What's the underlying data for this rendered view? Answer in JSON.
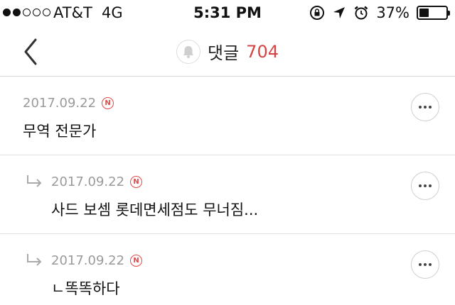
{
  "status_bar": {
    "carrier": "AT&T",
    "network": "4G",
    "time": "5:31 PM",
    "battery_percent": "37%",
    "battery_level": 0.37,
    "signal_bars_filled": 2,
    "signal_bars_total": 5,
    "icons": [
      "rotation-lock-icon",
      "location-arrow-icon",
      "alarm-clock-icon"
    ]
  },
  "nav": {
    "back_icon": "chevron-left-icon",
    "bell_icon": "bell-icon",
    "title": "댓글",
    "count": "704"
  },
  "colors": {
    "accent": "#d34545",
    "date": "#9a9a9a",
    "divider": "#e2e2e2"
  },
  "comments": [
    {
      "date": "2017.09.22",
      "badge": "N",
      "text": "무역 전문가",
      "is_reply": false
    },
    {
      "date": "2017.09.22",
      "badge": "N",
      "text": "사드 보셈 롯데면세점도 무너짐...",
      "is_reply": true
    },
    {
      "date": "2017.09.22",
      "badge": "N",
      "text": "ㄴ똑똑하다",
      "is_reply": true
    }
  ]
}
